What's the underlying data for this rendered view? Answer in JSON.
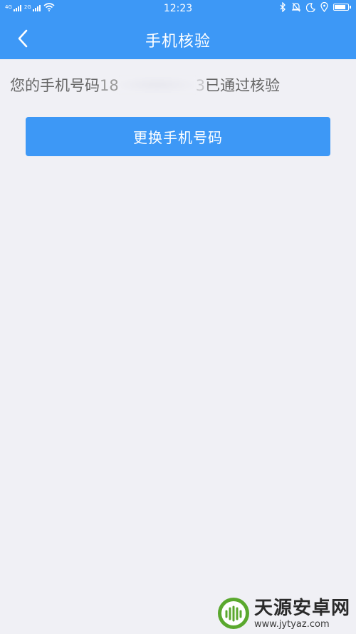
{
  "status_bar": {
    "time": "12:23",
    "signal_1_label": "4G",
    "signal_2_label": "2G",
    "battery_level": 0.85,
    "icons": [
      "signal-icon",
      "wifi-icon",
      "bluetooth-icon",
      "mute-icon",
      "moon-icon",
      "location-icon",
      "battery-icon"
    ]
  },
  "nav": {
    "title": "手机核验",
    "back_icon": "chevron-left-icon"
  },
  "verification": {
    "prefix": "您的手机号码",
    "phone_visible_start": "18",
    "phone_visible_end": "3",
    "suffix": "已通过核验"
  },
  "change_phone_button": {
    "label": "更换手机号码"
  },
  "watermark": {
    "name": "天源安卓网",
    "url": "www.jytyaz.com"
  },
  "colors": {
    "primary": "#3d98f6",
    "background": "#f0f0f5",
    "text": "#666666"
  }
}
